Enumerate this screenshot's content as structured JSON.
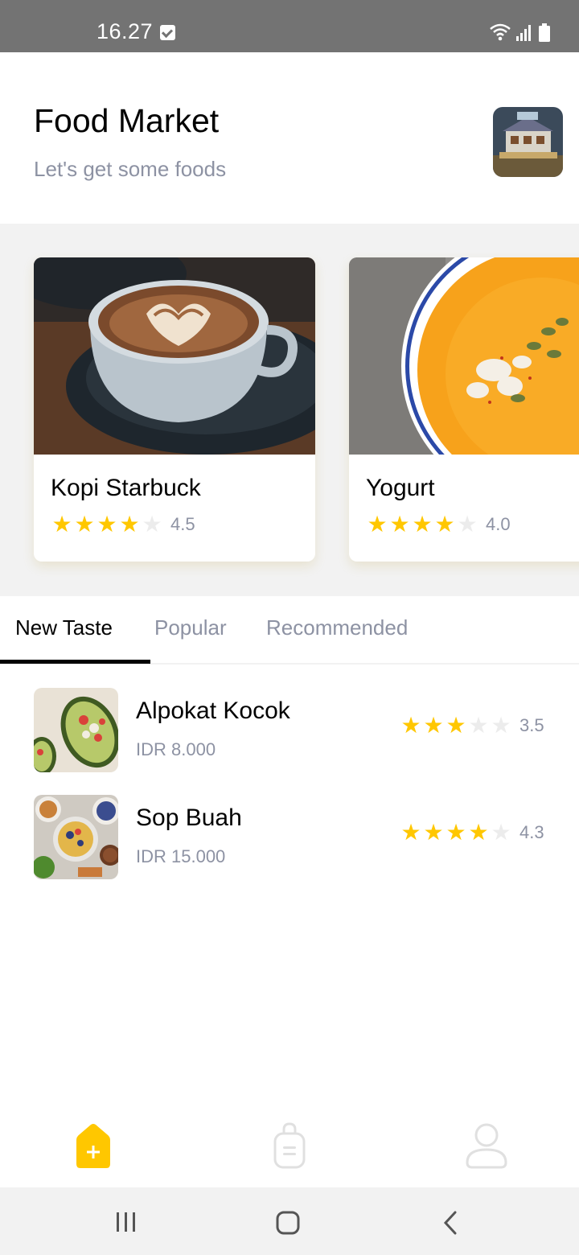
{
  "status_bar": {
    "time": "16.27"
  },
  "header": {
    "title": "Food Market",
    "subtitle": "Let's get some foods"
  },
  "featured": [
    {
      "name": "Kopi Starbuck",
      "rating": 4.5,
      "rating_text": "4.5",
      "filled_stars": 4
    },
    {
      "name": "Yogurt",
      "rating": 4.0,
      "rating_text": "4.0",
      "filled_stars": 4
    }
  ],
  "tabs": [
    {
      "label": "New Taste",
      "active": true
    },
    {
      "label": "Popular",
      "active": false
    },
    {
      "label": "Recommended",
      "active": false
    }
  ],
  "foods": [
    {
      "name": "Alpokat Kocok",
      "price": "IDR 8.000",
      "rating": 3.5,
      "rating_text": "3.5",
      "filled_stars": 3
    },
    {
      "name": "Sop Buah",
      "price": "IDR 15.000",
      "rating": 4.3,
      "rating_text": "4.3",
      "filled_stars": 4
    }
  ],
  "bottom_nav": [
    {
      "icon": "home-icon",
      "active": true
    },
    {
      "icon": "order-bag-icon",
      "active": false
    },
    {
      "icon": "profile-icon",
      "active": false
    }
  ],
  "colors": {
    "accent": "#ffc700",
    "text_dark": "#020202",
    "text_grey": "#8d92a3",
    "background_grey": "#f2f2f2",
    "status_bar": "#737373"
  }
}
